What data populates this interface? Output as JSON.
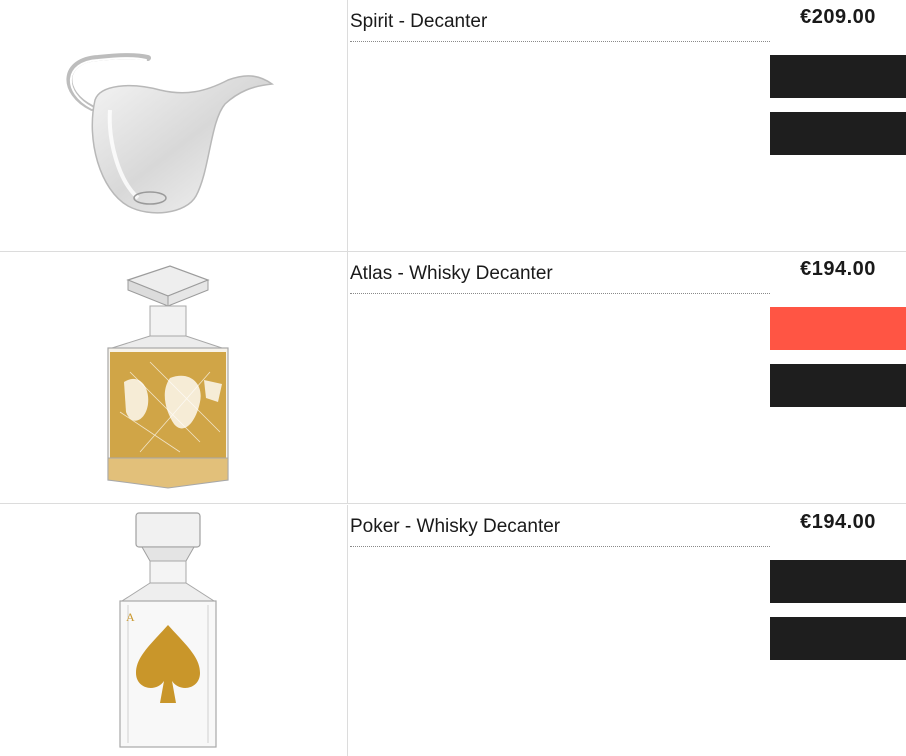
{
  "colors": {
    "button_dark": "#1e1e1e",
    "button_accent": "#ff5544",
    "divider": "#dcdcdc",
    "gold": "#c9962a"
  },
  "products": [
    {
      "name": "Spirit - Decanter",
      "price": "€209.00",
      "button_colors": [
        "#1e1e1e",
        "#1e1e1e"
      ],
      "image_icon": "carafe-icon"
    },
    {
      "name": "Atlas - Whisky Decanter",
      "price": "€194.00",
      "button_colors": [
        "#ff5544",
        "#1e1e1e"
      ],
      "image_icon": "world-map-decanter-icon"
    },
    {
      "name": "Poker - Whisky Decanter",
      "price": "€194.00",
      "button_colors": [
        "#1e1e1e",
        "#1e1e1e"
      ],
      "image_icon": "spade-decanter-icon"
    }
  ]
}
